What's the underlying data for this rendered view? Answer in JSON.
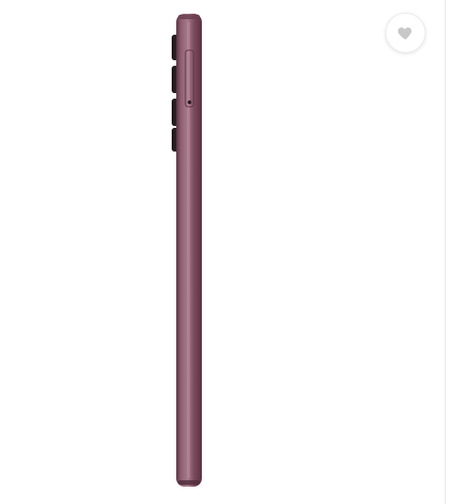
{
  "product": {
    "colors": {
      "body": "#7a4a5c",
      "body_highlight": "#a77a8b",
      "body_shadow": "#5a3242",
      "camera": "#2b2025"
    }
  },
  "wishlist": {
    "icon": "heart-icon",
    "color": "#c8c8c8"
  }
}
